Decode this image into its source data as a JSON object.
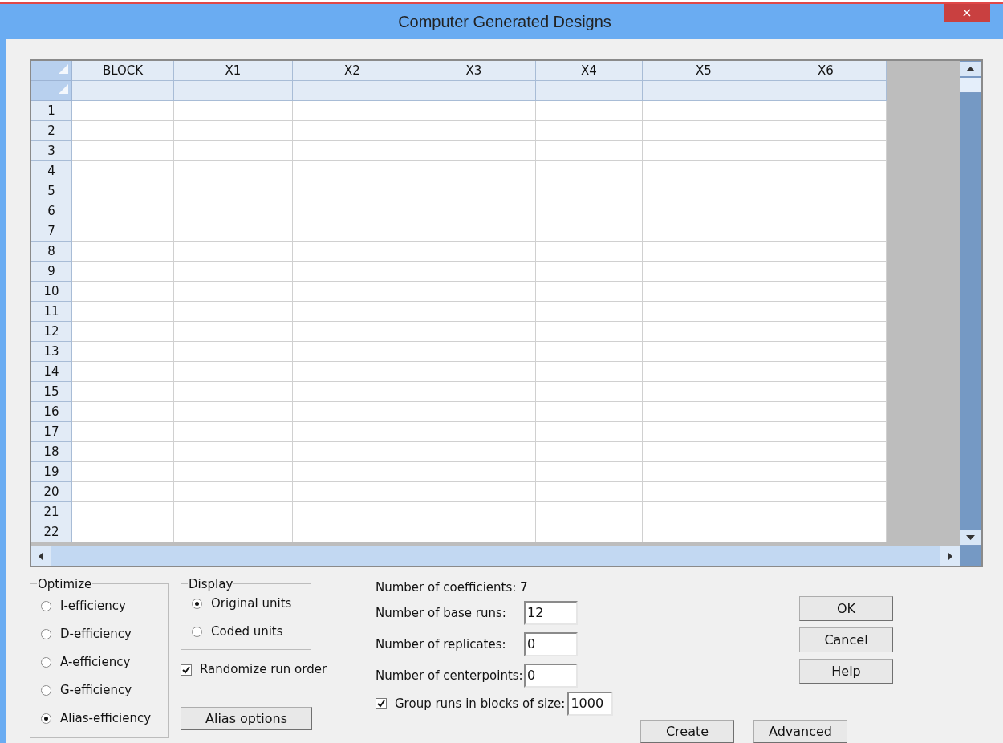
{
  "window": {
    "title": "Computer Generated Designs",
    "close": "×"
  },
  "grid": {
    "columns": [
      "BLOCK",
      "X1",
      "X2",
      "X3",
      "X4",
      "X5",
      "X6"
    ],
    "rows": [
      "1",
      "2",
      "3",
      "4",
      "5",
      "6",
      "7",
      "8",
      "9",
      "10",
      "11",
      "12",
      "13",
      "14",
      "15",
      "16",
      "17",
      "18",
      "19",
      "20",
      "21",
      "22"
    ]
  },
  "optimize": {
    "label": "Optimize",
    "options": [
      {
        "label": "I-efficiency",
        "selected": false
      },
      {
        "label": "D-efficiency",
        "selected": false
      },
      {
        "label": "A-efficiency",
        "selected": false
      },
      {
        "label": "G-efficiency",
        "selected": false
      },
      {
        "label": "Alias-efficiency",
        "selected": true
      }
    ]
  },
  "display": {
    "label": "Display",
    "options": [
      {
        "label": "Original units",
        "selected": true
      },
      {
        "label": "Coded units",
        "selected": false
      }
    ]
  },
  "randomize": {
    "label": "Randomize run order",
    "checked": true
  },
  "alias_button": "Alias options",
  "coefficients": "Number of coefficients: 7",
  "fields": [
    {
      "label": "Number of base runs:",
      "value": "12"
    },
    {
      "label": "Number of replicates:",
      "value": "0"
    },
    {
      "label": "Number of centerpoints:",
      "value": "0"
    }
  ],
  "group_blocks": {
    "label": "Group runs in blocks of size:",
    "checked": true,
    "value": "1000"
  },
  "bottom_buttons": [
    "Create",
    "Advanced"
  ],
  "side_buttons": [
    "OK",
    "Cancel",
    "Help"
  ]
}
